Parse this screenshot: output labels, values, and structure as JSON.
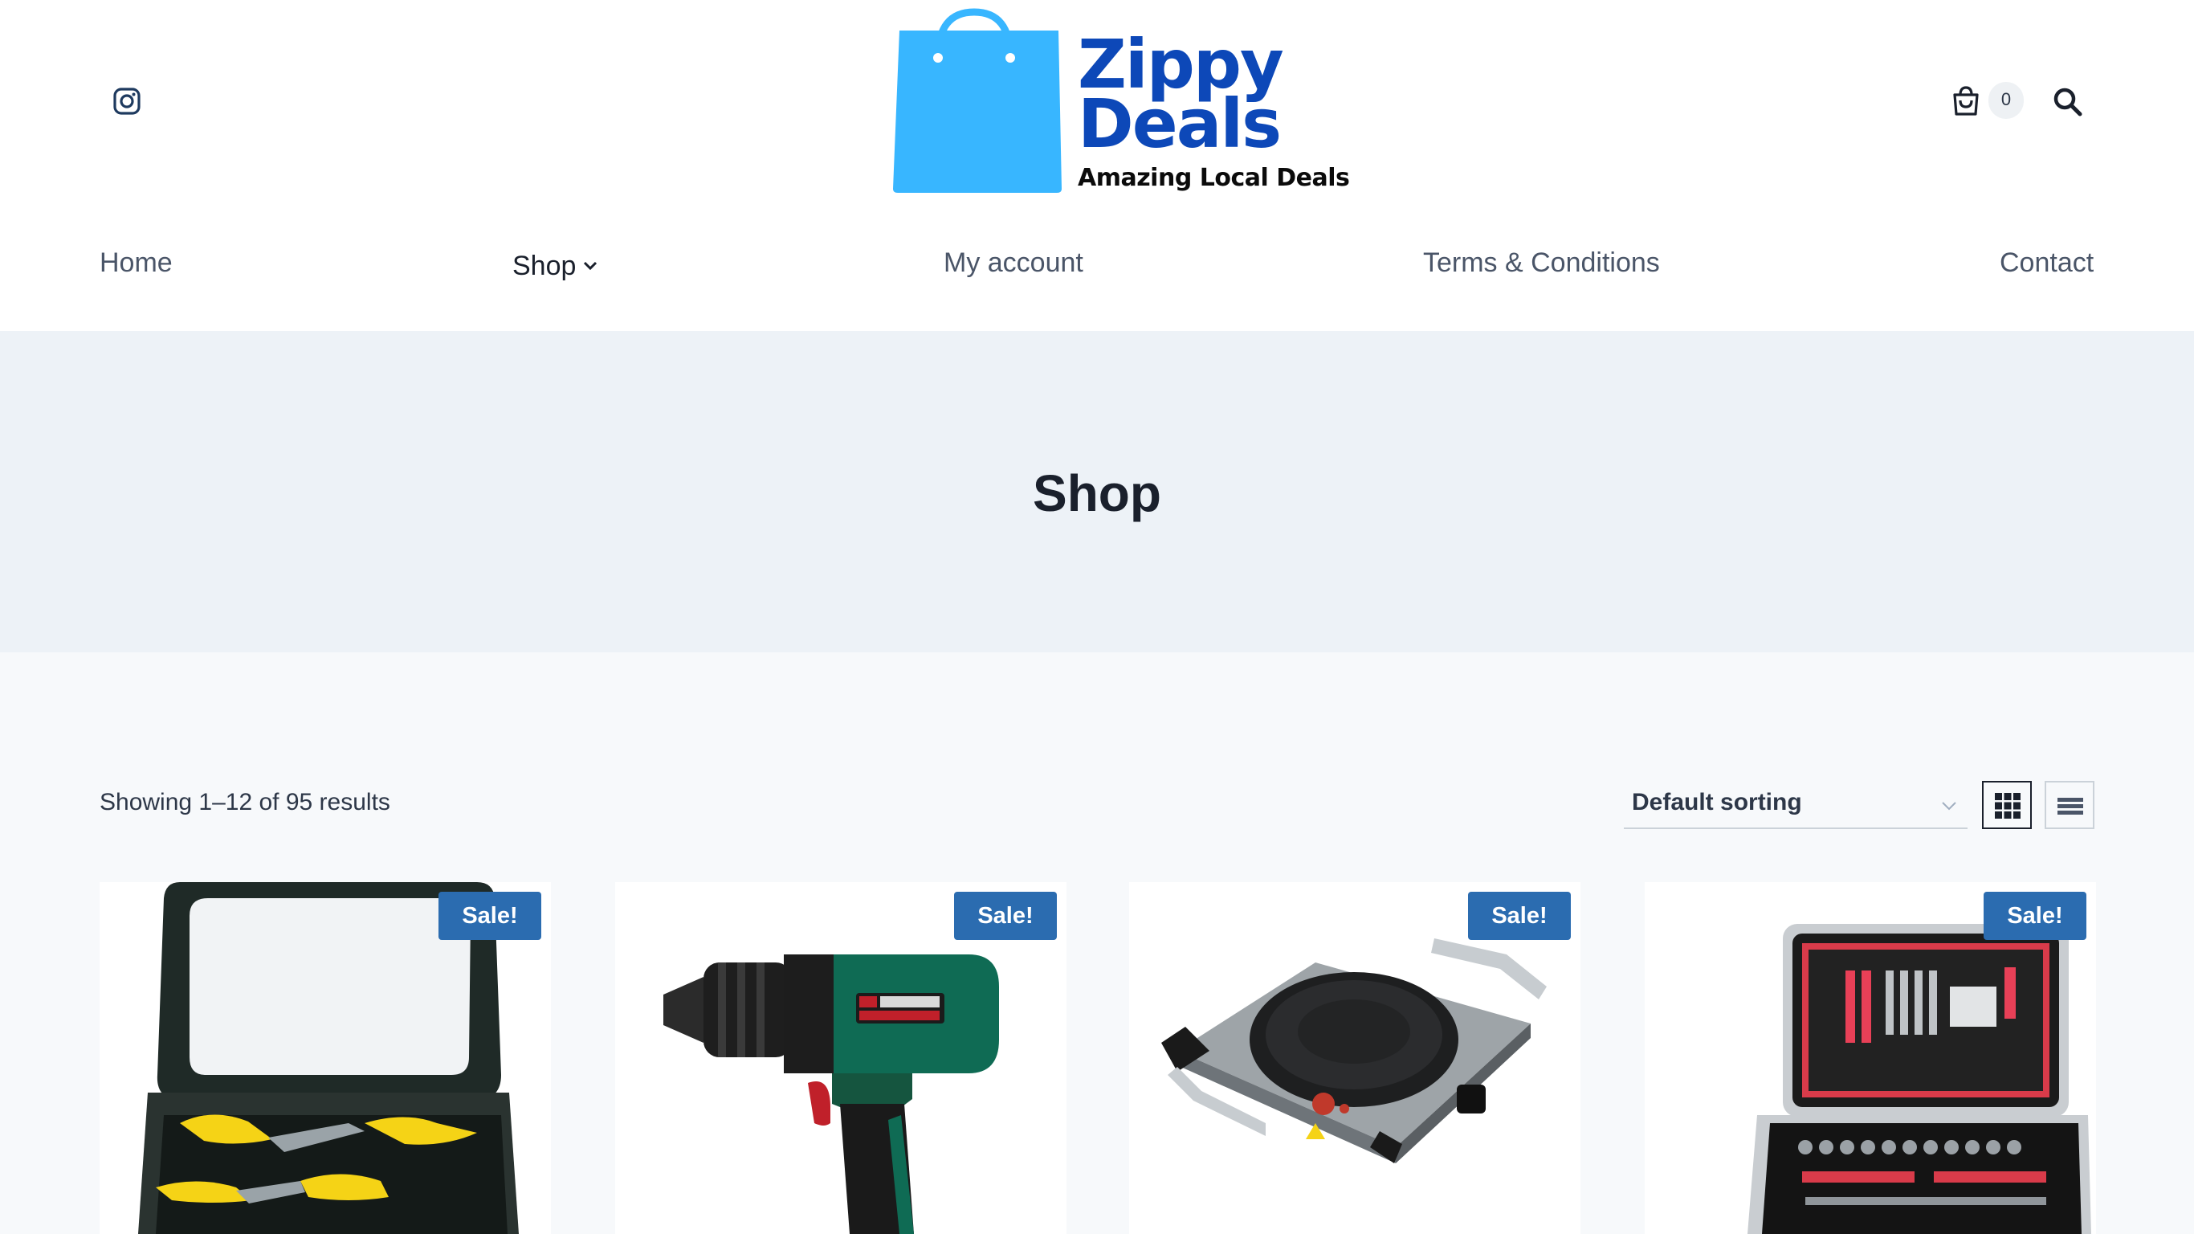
{
  "header": {
    "logo": {
      "word1": "Zippy",
      "word2": "Deals",
      "tagline": "Amazing Local Deals",
      "bag_color": "#38b6ff",
      "text_color": "#0d48b8"
    },
    "social_icon": "instagram-icon",
    "cart": {
      "icon": "cart-icon",
      "count": "0"
    },
    "search_icon": "search-icon"
  },
  "nav": {
    "items": [
      {
        "label": "Home"
      },
      {
        "label": "Shop",
        "has_dropdown": true,
        "active": true
      },
      {
        "label": "My account"
      },
      {
        "label": "Terms & Conditions"
      },
      {
        "label": "Contact"
      }
    ]
  },
  "hero": {
    "title": "Shop"
  },
  "toolbar": {
    "results_text": "Showing 1–12 of 95 results",
    "sort_selected": "Default sorting",
    "grid_view_icon": "grid-view-icon",
    "list_view_icon": "list-view-icon"
  },
  "products": [
    {
      "badge": "Sale!",
      "image": "tool-case-pliers"
    },
    {
      "badge": "Sale!",
      "image": "cordless-drill"
    },
    {
      "badge": "Sale!",
      "image": "hot-plate"
    },
    {
      "badge": "Sale!",
      "image": "tool-trolley-case"
    }
  ],
  "colors": {
    "accent": "#2b6cb0",
    "hero_bg": "#edf2f7",
    "page_bg": "#f7f9fb",
    "brand_blue": "#0d48b8"
  }
}
